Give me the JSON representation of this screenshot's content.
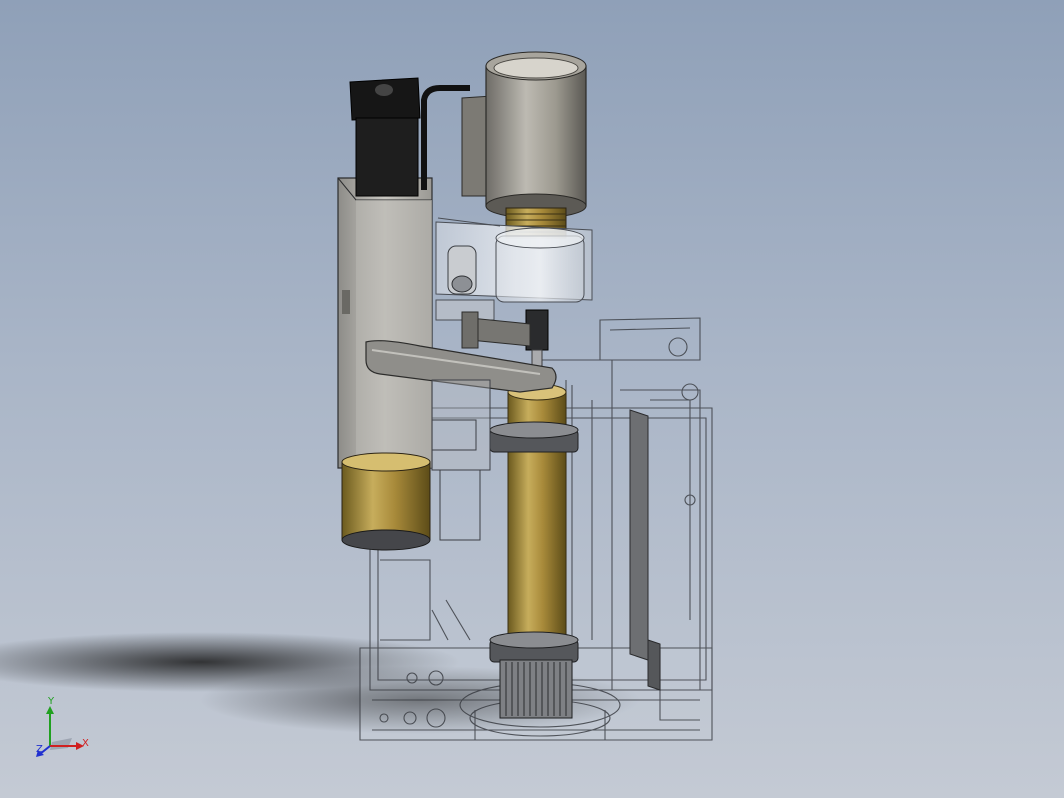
{
  "viewport": {
    "background_top": "#8fa0b8",
    "background_bottom": "#c4cad4"
  },
  "triad": {
    "x_label": "X",
    "y_label": "Y",
    "z_label": "Z",
    "x_color": "#d02020",
    "y_color": "#20a020",
    "z_color": "#2030d0"
  }
}
